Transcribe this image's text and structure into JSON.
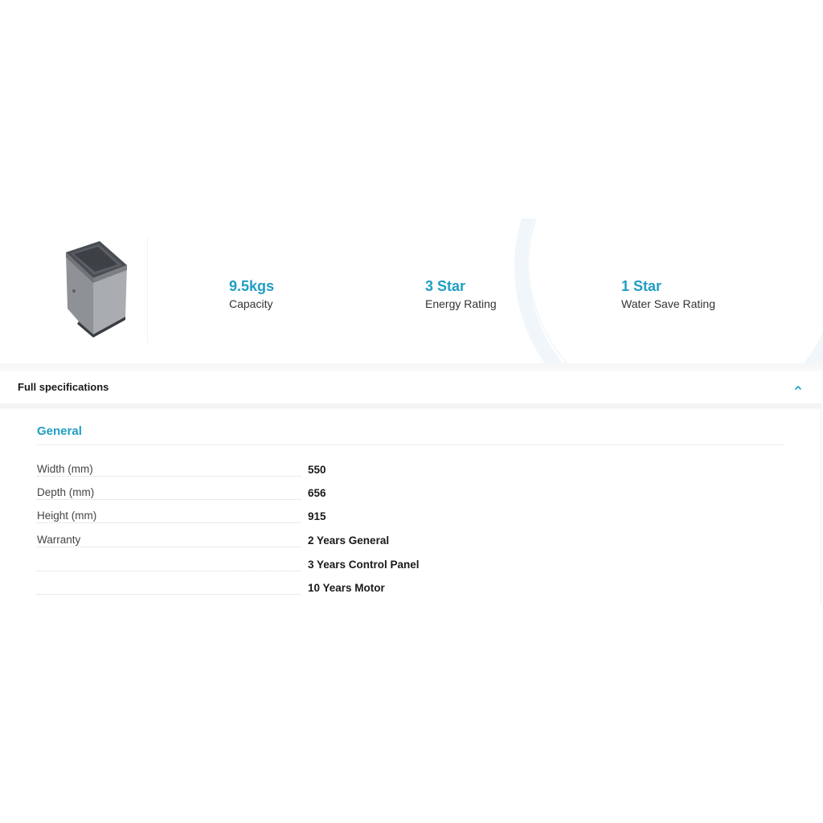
{
  "highlights": {
    "product_image_alt": "Top load washing machine",
    "stats": [
      {
        "value": "9.5kgs",
        "label": "Capacity"
      },
      {
        "value": "3 Star",
        "label": "Energy Rating"
      },
      {
        "value": "1 Star",
        "label": "Water Save Rating"
      }
    ]
  },
  "specifications": {
    "title": "Full specifications",
    "toggle_icon": "chevron-up-icon",
    "group": {
      "title": "General",
      "rows": [
        {
          "label": "Width (mm)",
          "value": "550"
        },
        {
          "label": "Depth (mm)",
          "value": "656"
        },
        {
          "label": "Height (mm)",
          "value": "915"
        },
        {
          "label": "Warranty",
          "value": "2 Years General"
        },
        {
          "label": "",
          "value": "3 Years Control Panel"
        },
        {
          "label": "",
          "value": "10 Years Motor"
        }
      ]
    }
  },
  "colors": {
    "accent": "#1f9ec3",
    "text": "#1a1a1a"
  }
}
